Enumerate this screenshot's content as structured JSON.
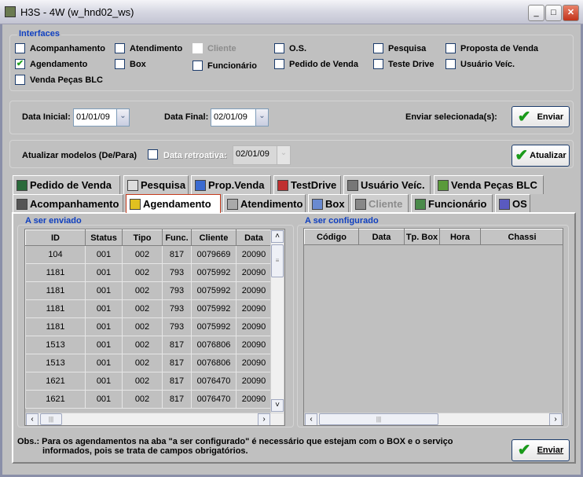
{
  "window": {
    "title": "H3S - 4W (w_hnd02_ws)"
  },
  "interfaces": {
    "label": "Interfaces",
    "items": [
      {
        "label": "Acompanhamento",
        "checked": false,
        "enabled": true
      },
      {
        "label": "Atendimento",
        "checked": false,
        "enabled": true
      },
      {
        "label": "Cliente",
        "checked": false,
        "enabled": false
      },
      {
        "label": "O.S.",
        "checked": false,
        "enabled": true
      },
      {
        "label": "Pesquisa",
        "checked": false,
        "enabled": true
      },
      {
        "label": "Proposta de Venda",
        "checked": false,
        "enabled": true
      },
      {
        "label": "Agendamento",
        "checked": true,
        "enabled": true
      },
      {
        "label": "Box",
        "checked": false,
        "enabled": true
      },
      {
        "label": "Funcionário",
        "checked": false,
        "enabled": true
      },
      {
        "label": "Pedido de Venda",
        "checked": false,
        "enabled": true
      },
      {
        "label": "Teste Drive",
        "checked": false,
        "enabled": true
      },
      {
        "label": "Usuário Veíc.",
        "checked": false,
        "enabled": true
      },
      {
        "label": "Venda Peças BLC",
        "checked": false,
        "enabled": true
      }
    ]
  },
  "filter": {
    "data_inicial_label": "Data Inicial:",
    "data_inicial": "01/01/09",
    "data_final_label": "Data Final:",
    "data_final": "02/01/09",
    "enviar_sel_label": "Enviar selecionada(s):",
    "enviar": "Enviar"
  },
  "atualizar": {
    "label": "Atualizar modelos (De/Para)",
    "checked": false,
    "retro_label": "Data retroativa:",
    "retro_value": "02/01/09",
    "button": "Atualizar"
  },
  "tabs_row1": [
    {
      "label": "Pedido de Venda",
      "icon": "calculator-icon"
    },
    {
      "label": "Pesquisa",
      "icon": "telescope-icon"
    },
    {
      "label": "Prop.Venda",
      "icon": "info-icon"
    },
    {
      "label": "TestDrive",
      "icon": "car-icon"
    },
    {
      "label": "Usuário Veíc.",
      "icon": "user-icon"
    },
    {
      "label": "Venda Peças BLC",
      "icon": "dollar-icon"
    }
  ],
  "tabs_row2": [
    {
      "label": "Acompanhamento",
      "icon": "film-icon"
    },
    {
      "label": "Agendamento",
      "icon": "alarm-clock-icon",
      "selected": true
    },
    {
      "label": "Atendimento",
      "icon": "database-icon"
    },
    {
      "label": "Box",
      "icon": "windows-icon"
    },
    {
      "label": "Cliente",
      "icon": "blank-icon",
      "disabled": true
    },
    {
      "label": "Funcionário",
      "icon": "gear-icon"
    },
    {
      "label": "OS",
      "icon": "list-icon"
    }
  ],
  "left": {
    "title": "A ser enviado",
    "columns": [
      "ID",
      "Status",
      "Tipo",
      "Func.",
      "Cliente",
      "Data"
    ],
    "rows": [
      [
        "104",
        "001",
        "002",
        "817",
        "0079669",
        "20090"
      ],
      [
        "1181",
        "001",
        "002",
        "793",
        "0075992",
        "20090"
      ],
      [
        "1181",
        "001",
        "002",
        "793",
        "0075992",
        "20090"
      ],
      [
        "1181",
        "001",
        "002",
        "793",
        "0075992",
        "20090"
      ],
      [
        "1181",
        "001",
        "002",
        "793",
        "0075992",
        "20090"
      ],
      [
        "1513",
        "001",
        "002",
        "817",
        "0076806",
        "20090"
      ],
      [
        "1513",
        "001",
        "002",
        "817",
        "0076806",
        "20090"
      ],
      [
        "1621",
        "001",
        "002",
        "817",
        "0076470",
        "20090"
      ],
      [
        "1621",
        "001",
        "002",
        "817",
        "0076470",
        "20090"
      ]
    ]
  },
  "right": {
    "title": "A ser configurado",
    "columns": [
      "Código",
      "Data",
      "Tp. Box",
      "Hora",
      "Chassi"
    ]
  },
  "obs": {
    "line1": "Obs.: Para os agendamentos na aba \"a ser configurado\" é necessário que estejam com o BOX e o serviço",
    "line2": "informados, pois se trata de campos obrigatórios."
  },
  "bottom": {
    "enviar": "Enviar"
  }
}
